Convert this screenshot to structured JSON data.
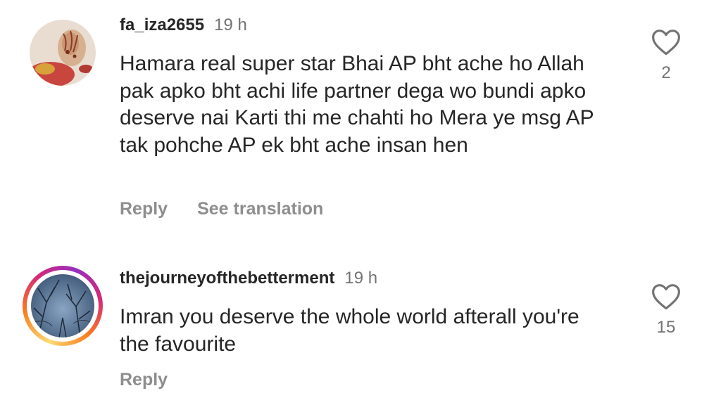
{
  "comments": [
    {
      "username": "fa_iza2655",
      "time": "19 h",
      "text": "Hamara real super star Bhai AP bht ache ho Allah pak apko bht achi life partner dega wo bundi apko deserve nai Karti thi me chahti ho Mera ye msg AP tak pohche AP ek bht ache insan hen",
      "actions": {
        "reply": "Reply",
        "translate": "See translation"
      },
      "likes": "2",
      "avatar_icon": "henna-hands-avatar"
    },
    {
      "username": "thejourneyofthebetterment",
      "time": "19 h",
      "text": "Imran you deserve the whole world afterall you're the favourite",
      "actions": {
        "reply": "Reply"
      },
      "likes": "15",
      "avatar_icon": "trees-sky-avatar",
      "has_story_ring": true
    }
  ],
  "colors": {
    "text": "#262626",
    "secondary": "#737373",
    "action": "#8e8e8e",
    "story_ring": [
      "#feda75",
      "#fa7e1e",
      "#d62976",
      "#962fbf"
    ]
  }
}
